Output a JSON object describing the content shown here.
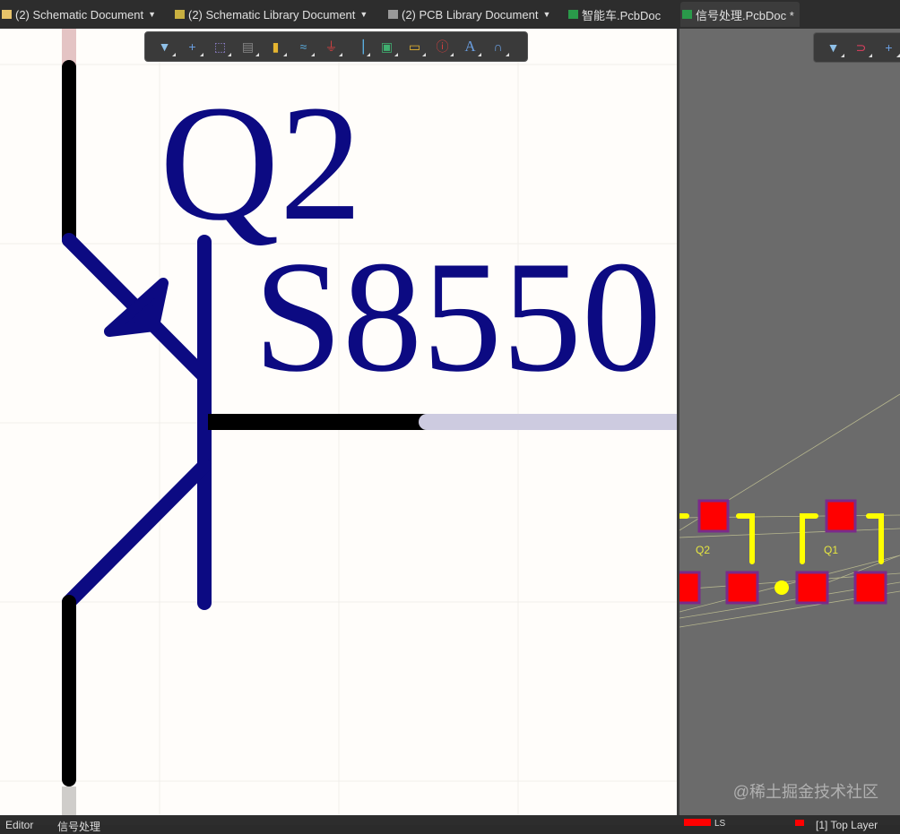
{
  "tabs": [
    {
      "label": "(2) Schematic Document",
      "dropdown": true,
      "icon": "schematic-doc-icon"
    },
    {
      "label": "(2) Schematic Library Document",
      "dropdown": true,
      "icon": "schlib-icon"
    },
    {
      "label": "(2) PCB Library Document",
      "dropdown": true,
      "icon": "pcblib-icon"
    },
    {
      "label": "智能车.PcbDoc",
      "dropdown": false,
      "icon": "pcb-doc-icon"
    },
    {
      "label": "信号处理.PcbDoc *",
      "dropdown": false,
      "icon": "pcb-doc-icon",
      "active": true
    }
  ],
  "schematic": {
    "designator": "Q2",
    "comment": "S8550",
    "ink_color": "#0c0a82"
  },
  "pcb": {
    "labels": [
      "Q2",
      "Q1"
    ],
    "pad_color": "#ff0000",
    "silk_color": "#ffff00"
  },
  "bottom": {
    "tabs": [
      "Editor",
      "信号处理"
    ],
    "layer": "[1] Top Layer",
    "ls": "LS"
  },
  "watermark": "@稀土掘金技术社区"
}
